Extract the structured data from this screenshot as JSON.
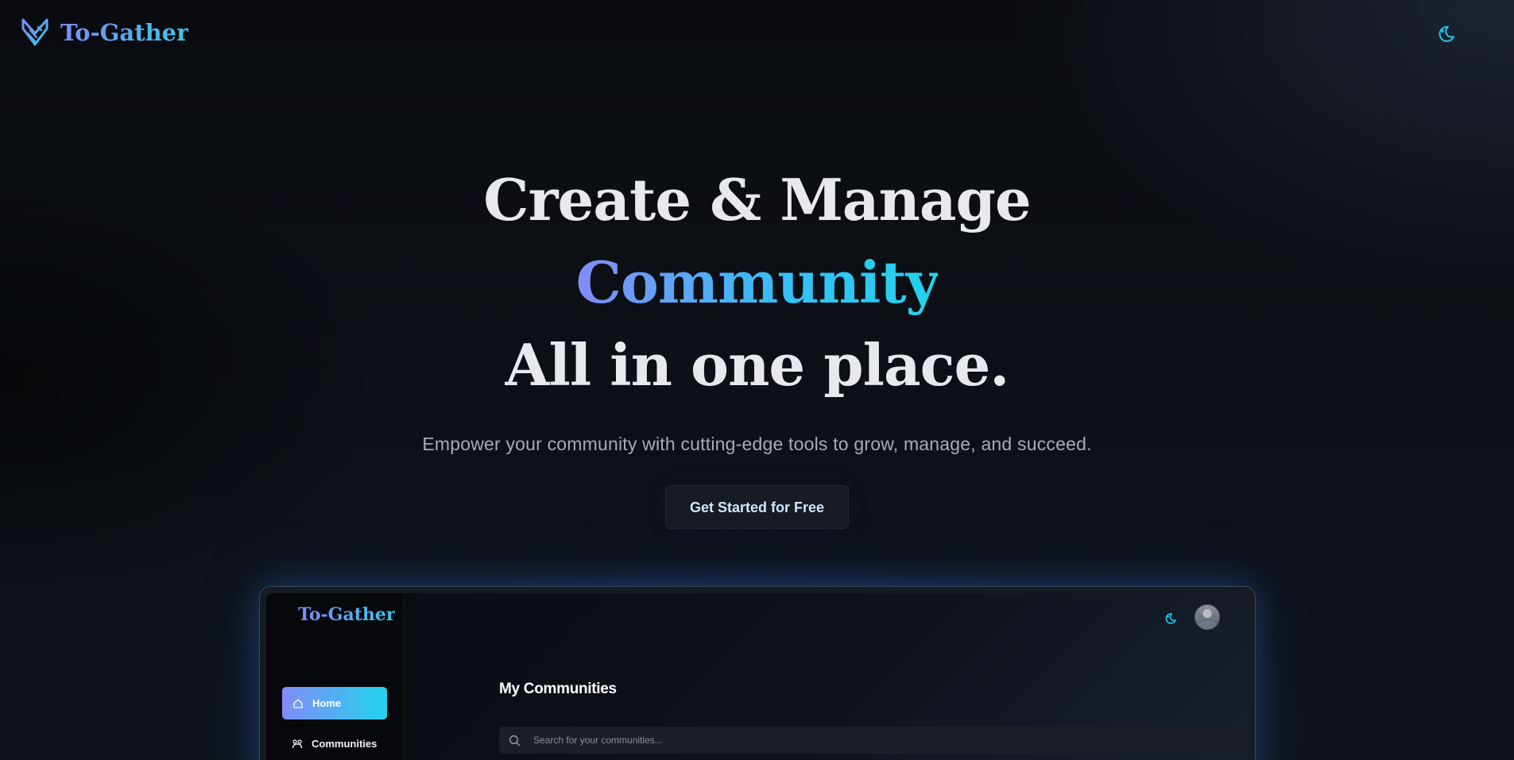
{
  "nav": {
    "brand": "To-Gather",
    "logo_icon": "to-gather-logo-icon",
    "theme_icon": "moon-icon"
  },
  "hero": {
    "line1": "Create & Manage",
    "line2": "Community",
    "line3": "All in one place.",
    "subtitle": "Empower your community with cutting-edge tools to grow, manage, and succeed.",
    "cta_label": "Get Started for Free"
  },
  "preview": {
    "brand": "To-Gather",
    "sidebar": {
      "items": [
        {
          "label": "Home",
          "icon": "home-icon",
          "active": true
        },
        {
          "label": "Communities",
          "icon": "communities-icon",
          "active": false
        }
      ]
    },
    "main": {
      "title": "My Communities",
      "search_placeholder": "Search for your communities..."
    }
  },
  "colors": {
    "accent_start": "#818cf8",
    "accent_end": "#22d3ee",
    "background": "#0b0d12",
    "text_primary": "#e8e9ec",
    "text_muted": "#a7acb5"
  }
}
